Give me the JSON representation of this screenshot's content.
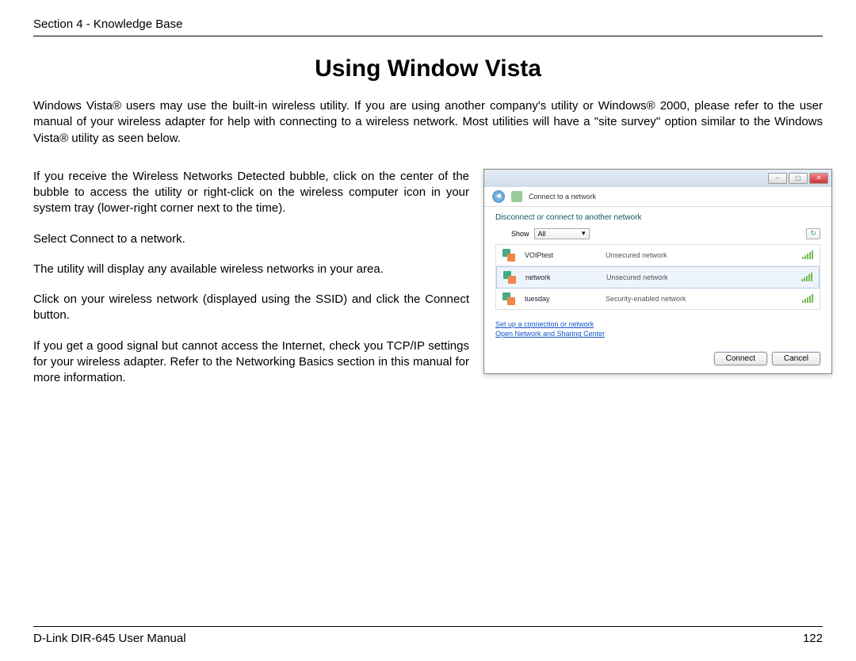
{
  "header": {
    "section": "Section 4 - Knowledge Base"
  },
  "title": "Using Window Vista",
  "intro": "Windows Vista® users may use the built-in wireless utility. If you are using another company's utility or Windows® 2000, please refer to the user manual of your wireless adapter for help with connecting to a wireless network. Most utilities will have a \"site survey\" option similar to the Windows Vista® utility as seen below.",
  "steps": {
    "p1": "If you receive the Wireless Networks Detected bubble, click on the center of the bubble to access the utility or right-click on the wireless computer icon in your system tray (lower-right corner next to the time).",
    "p2": "Select Connect to a network.",
    "p3": "The utility will display any available wireless networks in your area.",
    "p4": "Click on your wireless network (displayed using the SSID) and click the Connect button.",
    "p5": "If you get a good signal but cannot access the Internet, check you TCP/IP settings for your wireless adapter. Refer to the Networking Basics section in this manual for more information."
  },
  "window": {
    "crumb": "Connect to a network",
    "instruction": "Disconnect or connect to another network",
    "show_label": "Show",
    "show_value": "All",
    "networks": [
      {
        "name": "VOIPtest",
        "security": "Unsecured network",
        "selected": false
      },
      {
        "name": "network",
        "security": "Unsecured network",
        "selected": true
      },
      {
        "name": "tuesday",
        "security": "Security-enabled network",
        "selected": false
      }
    ],
    "link1": "Set up a connection or network",
    "link2": "Open Network and Sharing Center",
    "connect": "Connect",
    "cancel": "Cancel"
  },
  "footer": {
    "left": "D-Link DIR-645 User Manual",
    "right": "122"
  }
}
